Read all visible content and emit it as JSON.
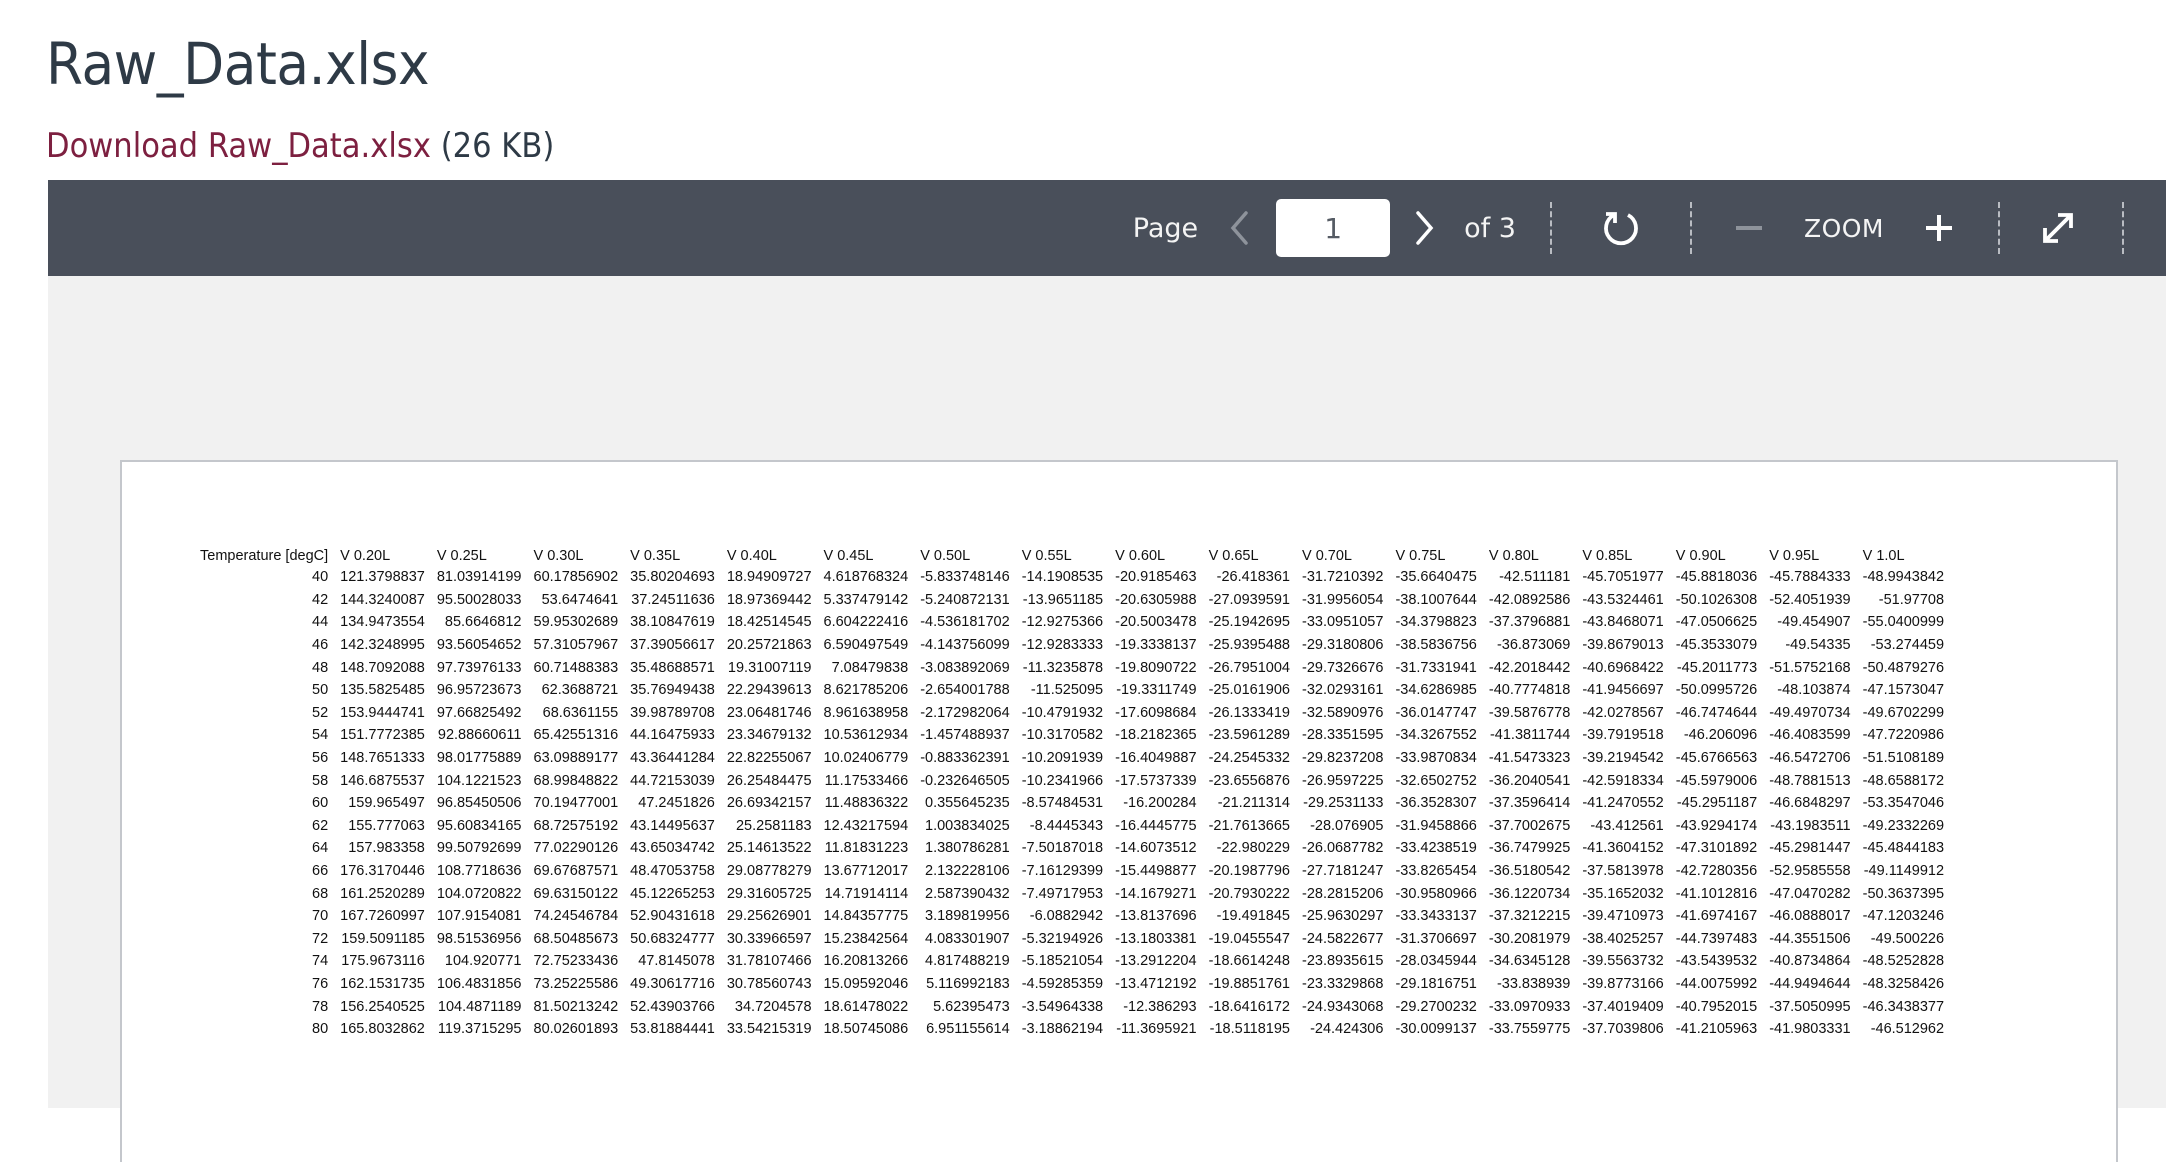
{
  "document": {
    "title": "Raw_Data.xlsx",
    "download_label": "Download Raw_Data.xlsx",
    "file_size": "(26 KB)"
  },
  "toolbar": {
    "page_label": "Page",
    "current_page": "1",
    "total_pages_label": "of 3",
    "zoom_label": "ZOOM",
    "icons": {
      "prev": "chevron-left-icon",
      "next": "chevron-right-icon",
      "rotate": "rotate-icon",
      "zoom_out": "minus-icon",
      "zoom_in": "plus-icon",
      "fullscreen": "expand-icon"
    },
    "colors": {
      "bar": "#494f5a",
      "disabled": "#8e939b",
      "link": "#7d2040"
    }
  },
  "table": {
    "headers": [
      "Temperature [degC]",
      "V 0.20L",
      "V 0.25L",
      "V 0.30L",
      "V 0.35L",
      "V 0.40L",
      "V 0.45L",
      "V 0.50L",
      "V 0.55L",
      "V 0.60L",
      "V 0.65L",
      "V 0.70L",
      "V 0.75L",
      "V 0.80L",
      "V 0.85L",
      "V 0.90L",
      "V 0.95L",
      "V 1.0L"
    ],
    "rows": [
      [
        "40",
        "121.3798837",
        "81.03914199",
        "60.17856902",
        "35.80204693",
        "18.94909727",
        "4.618768324",
        "-5.833748146",
        "-14.1908535",
        "-20.9185463",
        "-26.418361",
        "-31.7210392",
        "-35.6640475",
        "-42.511181",
        "-45.7051977",
        "-45.8818036",
        "-45.7884333",
        "-48.9943842"
      ],
      [
        "42",
        "144.3240087",
        "95.50028033",
        "53.6474641",
        "37.24511636",
        "18.97369442",
        "5.337479142",
        "-5.240872131",
        "-13.9651185",
        "-20.6305988",
        "-27.0939591",
        "-31.9956054",
        "-38.1007644",
        "-42.0892586",
        "-43.5324461",
        "-50.1026308",
        "-52.4051939",
        "-51.97708"
      ],
      [
        "44",
        "134.9473554",
        "85.6646812",
        "59.95302689",
        "38.10847619",
        "18.42514545",
        "6.604222416",
        "-4.536181702",
        "-12.9275366",
        "-20.5003478",
        "-25.1942695",
        "-33.0951057",
        "-34.3798823",
        "-37.3796881",
        "-43.8468071",
        "-47.0506625",
        "-49.454907",
        "-55.0400999"
      ],
      [
        "46",
        "142.3248995",
        "93.56054652",
        "57.31057967",
        "37.39056617",
        "20.25721863",
        "6.590497549",
        "-4.143756099",
        "-12.9283333",
        "-19.3338137",
        "-25.9395488",
        "-29.3180806",
        "-38.5836756",
        "-36.873069",
        "-39.8679013",
        "-45.3533079",
        "-49.54335",
        "-53.274459"
      ],
      [
        "48",
        "148.7092088",
        "97.73976133",
        "60.71488383",
        "35.48688571",
        "19.31007119",
        "7.08479838",
        "-3.083892069",
        "-11.3235878",
        "-19.8090722",
        "-26.7951004",
        "-29.7326676",
        "-31.7331941",
        "-42.2018442",
        "-40.6968422",
        "-45.2011773",
        "-51.5752168",
        "-50.4879276"
      ],
      [
        "50",
        "135.5825485",
        "96.95723673",
        "62.3688721",
        "35.76949438",
        "22.29439613",
        "8.621785206",
        "-2.654001788",
        "-11.525095",
        "-19.3311749",
        "-25.0161906",
        "-32.0293161",
        "-34.6286985",
        "-40.7774818",
        "-41.9456697",
        "-50.0995726",
        "-48.103874",
        "-47.1573047"
      ],
      [
        "52",
        "153.9444741",
        "97.66825492",
        "68.6361155",
        "39.98789708",
        "23.06481746",
        "8.961638958",
        "-2.172982064",
        "-10.4791932",
        "-17.6098684",
        "-26.1333419",
        "-32.5890976",
        "-36.0147747",
        "-39.5876778",
        "-42.0278567",
        "-46.7474644",
        "-49.4970734",
        "-49.6702299"
      ],
      [
        "54",
        "151.7772385",
        "92.88660611",
        "65.42551316",
        "44.16475933",
        "23.34679132",
        "10.53612934",
        "-1.457488937",
        "-10.3170582",
        "-18.2182365",
        "-23.5961289",
        "-28.3351595",
        "-34.3267552",
        "-41.3811744",
        "-39.7919518",
        "-46.206096",
        "-46.4083599",
        "-47.7220986"
      ],
      [
        "56",
        "148.7651333",
        "98.01775889",
        "63.09889177",
        "43.36441284",
        "22.82255067",
        "10.02406779",
        "-0.883362391",
        "-10.2091939",
        "-16.4049887",
        "-24.2545332",
        "-29.8237208",
        "-33.9870834",
        "-41.5473323",
        "-39.2194542",
        "-45.6766563",
        "-46.5472706",
        "-51.5108189"
      ],
      [
        "58",
        "146.6875537",
        "104.1221523",
        "68.99848822",
        "44.72153039",
        "26.25484475",
        "11.17533466",
        "-0.232646505",
        "-10.2341966",
        "-17.5737339",
        "-23.6556876",
        "-26.9597225",
        "-32.6502752",
        "-36.2040541",
        "-42.5918334",
        "-45.5979006",
        "-48.7881513",
        "-48.6588172"
      ],
      [
        "60",
        "159.965497",
        "96.85450506",
        "70.19477001",
        "47.2451826",
        "26.69342157",
        "11.48836322",
        "0.355645235",
        "-8.57484531",
        "-16.200284",
        "-21.211314",
        "-29.2531133",
        "-36.3528307",
        "-37.3596414",
        "-41.2470552",
        "-45.2951187",
        "-46.6848297",
        "-53.3547046"
      ],
      [
        "62",
        "155.777063",
        "95.60834165",
        "68.72575192",
        "43.14495637",
        "25.2581183",
        "12.43217594",
        "1.003834025",
        "-8.4445343",
        "-16.4445775",
        "-21.7613665",
        "-28.076905",
        "-31.9458866",
        "-37.7002675",
        "-43.412561",
        "-43.9294174",
        "-43.1983511",
        "-49.2332269"
      ],
      [
        "64",
        "157.983358",
        "99.50792699",
        "77.02290126",
        "43.65034742",
        "25.14613522",
        "11.81831223",
        "1.380786281",
        "-7.50187018",
        "-14.6073512",
        "-22.980229",
        "-26.0687782",
        "-33.4238519",
        "-36.7479925",
        "-41.3604152",
        "-47.3101892",
        "-45.2981447",
        "-45.4844183"
      ],
      [
        "66",
        "176.3170446",
        "108.7718636",
        "69.67687571",
        "48.47053758",
        "29.08778279",
        "13.67712017",
        "2.132228106",
        "-7.16129399",
        "-15.4498877",
        "-20.1987796",
        "-27.7181247",
        "-33.8265454",
        "-36.5180542",
        "-37.5813978",
        "-42.7280356",
        "-52.9585558",
        "-49.1149912"
      ],
      [
        "68",
        "161.2520289",
        "104.0720822",
        "69.63150122",
        "45.12265253",
        "29.31605725",
        "14.71914114",
        "2.587390432",
        "-7.49717953",
        "-14.1679271",
        "-20.7930222",
        "-28.2815206",
        "-30.9580966",
        "-36.1220734",
        "-35.1652032",
        "-41.1012816",
        "-47.0470282",
        "-50.3637395"
      ],
      [
        "70",
        "167.7260997",
        "107.9154081",
        "74.24546784",
        "52.90431618",
        "29.25626901",
        "14.84357775",
        "3.189819956",
        "-6.0882942",
        "-13.8137696",
        "-19.491845",
        "-25.9630297",
        "-33.3433137",
        "-37.3212215",
        "-39.4710973",
        "-41.6974167",
        "-46.0888017",
        "-47.1203246"
      ],
      [
        "72",
        "159.5091185",
        "98.51536956",
        "68.50485673",
        "50.68324777",
        "30.33966597",
        "15.23842564",
        "4.083301907",
        "-5.32194926",
        "-13.1803381",
        "-19.0455547",
        "-24.5822677",
        "-31.3706697",
        "-30.2081979",
        "-38.4025257",
        "-44.7397483",
        "-44.3551506",
        "-49.500226"
      ],
      [
        "74",
        "175.9673116",
        "104.920771",
        "72.75233436",
        "47.8145078",
        "31.78107466",
        "16.20813266",
        "4.817488219",
        "-5.18521054",
        "-13.2912204",
        "-18.6614248",
        "-23.8935615",
        "-28.0345944",
        "-34.6345128",
        "-39.5563732",
        "-43.5439532",
        "-40.8734864",
        "-48.5252828"
      ],
      [
        "76",
        "162.1531735",
        "106.4831856",
        "73.25225586",
        "49.30617716",
        "30.78560743",
        "15.09592046",
        "5.116992183",
        "-4.59285359",
        "-13.4712192",
        "-19.8851761",
        "-23.3329868",
        "-29.1816751",
        "-33.838939",
        "-39.8773166",
        "-44.0075992",
        "-44.9494644",
        "-48.3258426"
      ],
      [
        "78",
        "156.2540525",
        "104.4871189",
        "81.50213242",
        "52.43903766",
        "34.7204578",
        "18.61478022",
        "5.62395473",
        "-3.54964338",
        "-12.386293",
        "-18.6416172",
        "-24.9343068",
        "-29.2700232",
        "-33.0970933",
        "-37.4019409",
        "-40.7952015",
        "-37.5050995",
        "-46.3438377"
      ],
      [
        "80",
        "165.8032862",
        "119.3715295",
        "80.02601893",
        "53.81884441",
        "33.54215319",
        "18.50745086",
        "6.951155614",
        "-3.18862194",
        "-11.3695921",
        "-18.5118195",
        "-24.424306",
        "-30.0099137",
        "-33.7559775",
        "-37.7039806",
        "-41.2105963",
        "-41.9803331",
        "-46.512962"
      ]
    ]
  }
}
